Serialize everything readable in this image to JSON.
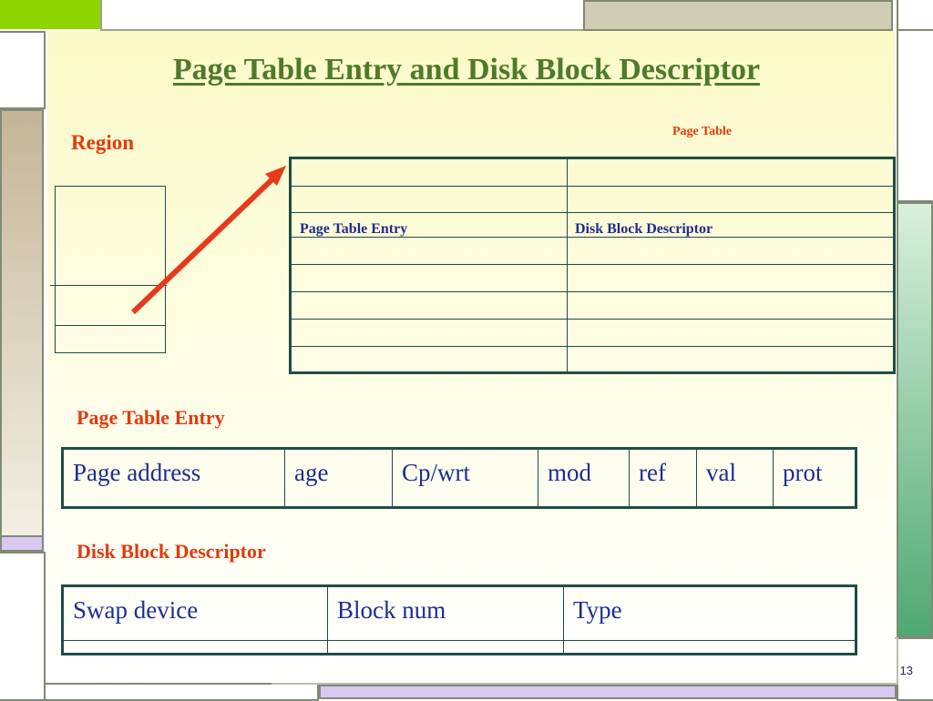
{
  "slide": {
    "title": "Page Table Entry and Disk Block Descriptor",
    "page_number": "13"
  },
  "region": {
    "label": "Region"
  },
  "page_table": {
    "label": "Page Table",
    "entry_label": "Page Table Entry",
    "descriptor_label": "Disk Block Descriptor"
  },
  "pte": {
    "label": "Page Table Entry",
    "fields": [
      "Page address",
      "age",
      "Cp/wrt",
      "mod",
      "ref",
      "val",
      "prot"
    ]
  },
  "dbd": {
    "label": "Disk Block Descriptor",
    "fields": [
      "Swap device",
      "Block num",
      "Type"
    ]
  },
  "colors": {
    "title": "#4e7a2c",
    "label_red": "#e23a0e",
    "label_blue": "#1f2d90",
    "table_border": "#1f4d45",
    "arrow": "#e8391a",
    "accent_green": "#8ed400",
    "accent_tan": "#c4b597",
    "accent_lavender": "#d9c8f0",
    "accent_teal": "#5fb48c"
  }
}
